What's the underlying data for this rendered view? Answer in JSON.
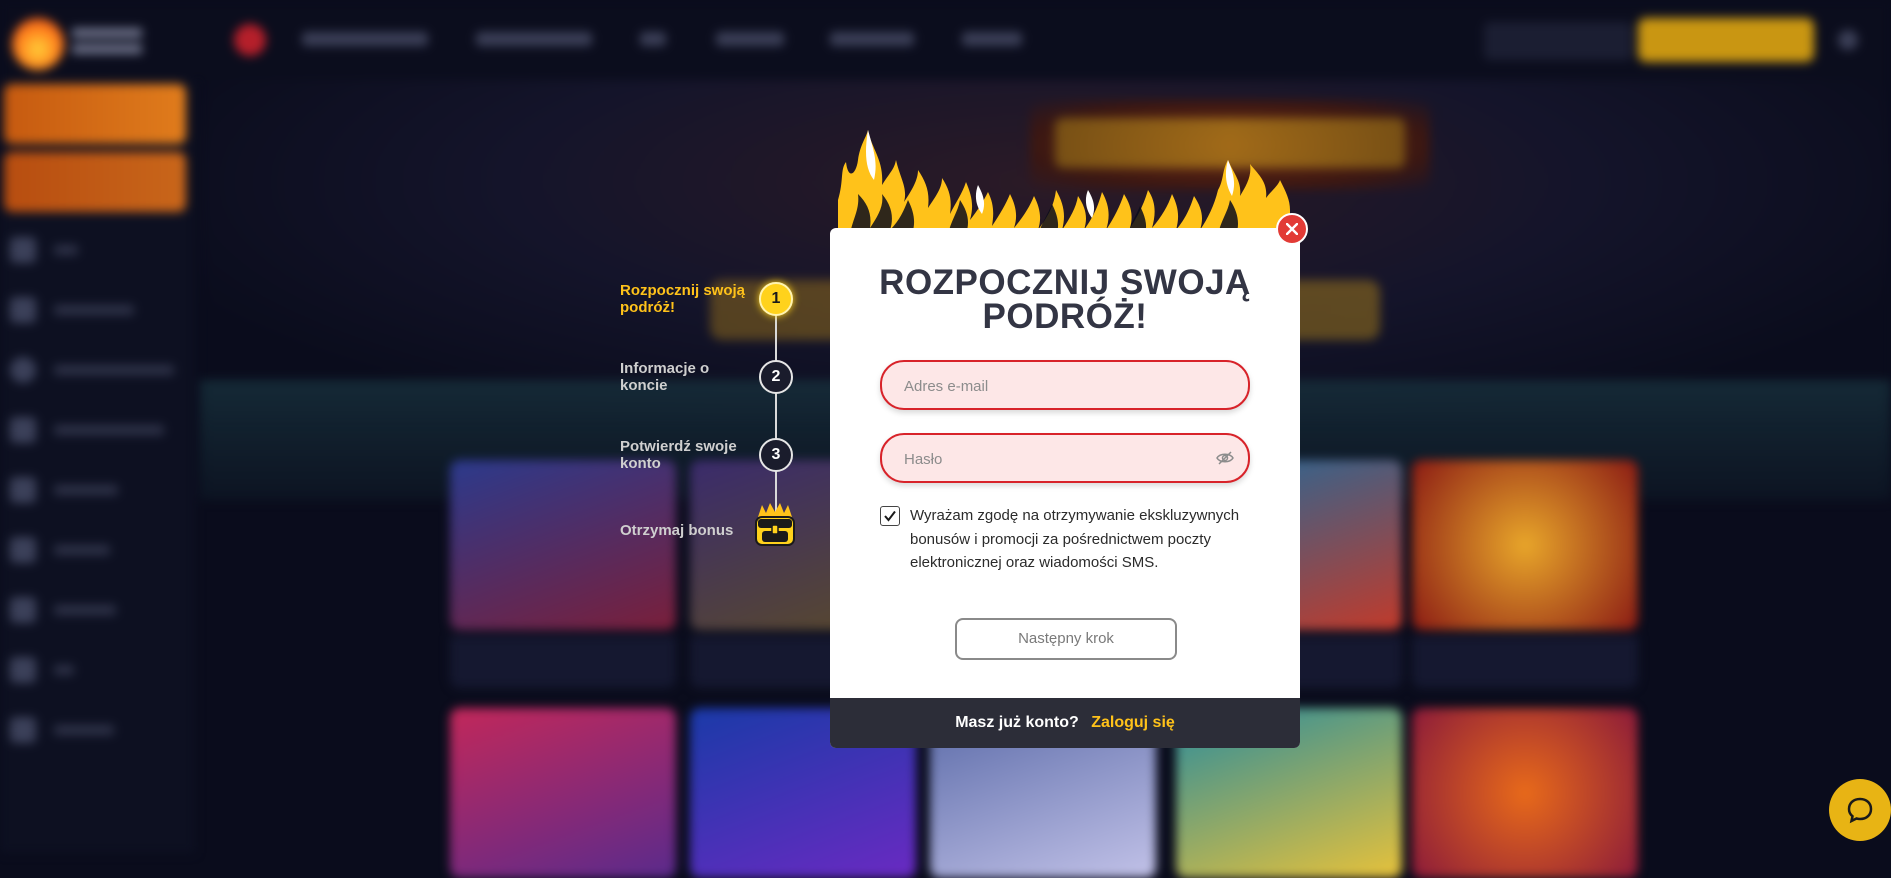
{
  "stepper": {
    "steps": [
      {
        "label": "Rozpocznij swoją podróż!",
        "number": "1",
        "active": true
      },
      {
        "label": "Informacje o koncie",
        "number": "2",
        "active": false
      },
      {
        "label": "Potwierdź swoje konto",
        "number": "3",
        "active": false
      },
      {
        "label": "Otrzymaj bonus",
        "icon": "treasure-chest-icon",
        "active": false
      }
    ]
  },
  "modal": {
    "title": "ROZPOCZNIJ SWOJĄ PODRÓŻ!",
    "email_placeholder": "Adres e-mail",
    "email_value": "",
    "password_placeholder": "Hasło",
    "password_value": "",
    "password_toggle_icon": "eye-slash-icon",
    "consent_checked": true,
    "consent_text": "Wyrażam zgodę na otrzymywanie ekskluzywnych bonusów i promocji za pośrednictwem poczty elektronicznej oraz wiadomości SMS.",
    "next_button": "Następny krok",
    "footer_question": "Masz już konto?",
    "footer_login_link": "Zaloguj się",
    "close_icon": "close-icon"
  },
  "colors": {
    "accent_yellow": "#ffc21a",
    "error_red": "#d8232a",
    "field_bg": "#fde7e7",
    "footer_bg": "#2c2d38",
    "backdrop": "#0a0c1c"
  },
  "chat_widget_icon": "chat-bubble-icon"
}
